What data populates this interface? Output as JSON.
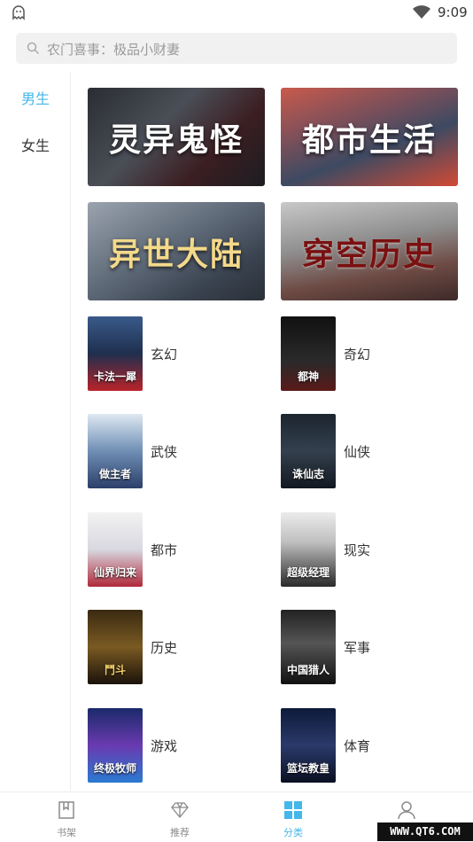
{
  "status_bar": {
    "time": "9:09",
    "app_icon": "ghost-icon",
    "wifi_icon": "wifi-icon"
  },
  "search": {
    "placeholder": "农门喜事：极品小财妻",
    "icon": "search-icon"
  },
  "sidebar": {
    "items": [
      {
        "label": "男生",
        "active": true
      },
      {
        "label": "女生",
        "active": false
      }
    ]
  },
  "banners": [
    {
      "label": "灵异鬼怪"
    },
    {
      "label": "都市生活"
    },
    {
      "label": "异世大陆"
    },
    {
      "label": "穿空历史"
    }
  ],
  "categories": [
    {
      "label": "玄幻",
      "cover_text": "卡法一犀"
    },
    {
      "label": "奇幻",
      "cover_text": "都神"
    },
    {
      "label": "武侠",
      "cover_text": "做主者"
    },
    {
      "label": "仙侠",
      "cover_text": "诛仙志"
    },
    {
      "label": "都市",
      "cover_text": "仙界归来"
    },
    {
      "label": "现实",
      "cover_text": "超级经理"
    },
    {
      "label": "历史",
      "cover_text": "鬥斗"
    },
    {
      "label": "军事",
      "cover_text": "中国猎人"
    },
    {
      "label": "游戏",
      "cover_text": "终极牧师"
    },
    {
      "label": "体育",
      "cover_text": "篮坛教皇"
    }
  ],
  "tabbar": {
    "tabs": [
      {
        "label": "书架",
        "icon": "bookmark-icon"
      },
      {
        "label": "推荐",
        "icon": "diamond-icon"
      },
      {
        "label": "分类",
        "icon": "grid-icon",
        "active": true
      },
      {
        "label": "",
        "icon": "person-icon"
      }
    ]
  },
  "watermark": "WWW.QT6.COM",
  "colors": {
    "accent": "#45b7ea"
  }
}
